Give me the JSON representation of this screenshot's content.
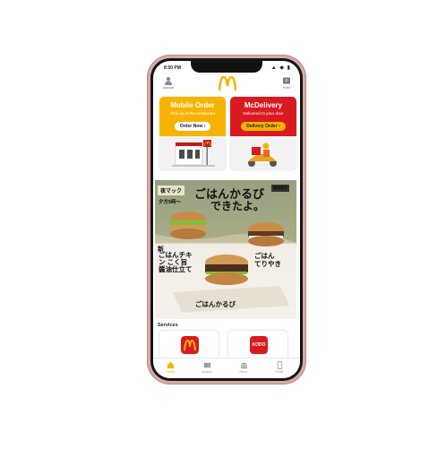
{
  "status_bar": {
    "time": "8:50 PM",
    "icons": "▲ ◆ ▮"
  },
  "header": {
    "account_label": "Account",
    "point_label": "Point"
  },
  "mobile_order": {
    "title": "Mobile Order",
    "subtitle": "Pick up at the restaurant",
    "button": "Order Now",
    "color": "#f6b400"
  },
  "mcdelivery": {
    "title": "McDelivery",
    "subtitle": "Delivered to your door",
    "button": "Delivery Order",
    "color": "#da1a21"
  },
  "banner": {
    "tag": "夜マック",
    "time": "夕方5時～",
    "headline1": "ごはんかるび",
    "headline2": "できたよ。",
    "new1": "新",
    "chicken": "ごはんチキン こく旨 醤油仕立て",
    "teriyaki": "ごはん てりやき",
    "karubi": "ごはんかるび",
    "badge": "期間限定"
  },
  "services": {
    "label": "Services",
    "kodo": "KODO"
  },
  "tabs": [
    {
      "label": "Home",
      "icon": "home-icon"
    },
    {
      "label": "Coupon",
      "icon": "coupon-icon"
    },
    {
      "label": "Menu",
      "icon": "burger-icon"
    },
    {
      "label": "Order",
      "icon": "phone-icon"
    }
  ],
  "colors": {
    "brand_yellow": "#f6b400",
    "brand_red": "#da1a21"
  }
}
